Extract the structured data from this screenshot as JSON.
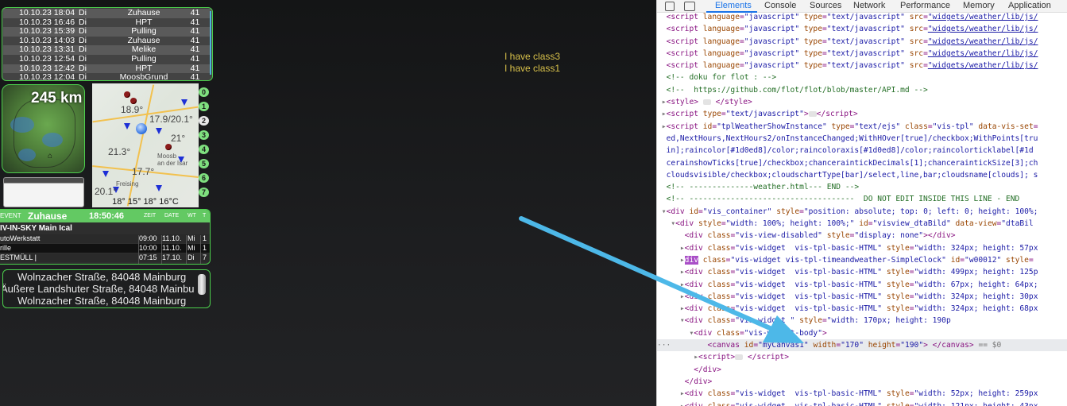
{
  "history": [
    [
      "10.10.23 18:04",
      "Di",
      "Zuhause",
      "41"
    ],
    [
      "10.10.23 16:46",
      "Di",
      "HPT",
      "41"
    ],
    [
      "10.10.23 15:39",
      "Di",
      "Pulling",
      "41"
    ],
    [
      "10.10.23 14:03",
      "Di",
      "Zuhause",
      "41"
    ],
    [
      "10.10.23 13:31",
      "Di",
      "Melike",
      "41"
    ],
    [
      "10.10.23 12:54",
      "Di",
      "Pulling",
      "41"
    ],
    [
      "10.10.23 12:42",
      "Di",
      "HPT",
      "41"
    ],
    [
      "10.10.23 12:04",
      "Di",
      "MoosbGrund",
      "41"
    ]
  ],
  "radar": {
    "distance": "245 km"
  },
  "weather_map": {
    "temps": [
      "18.9°",
      "17.9/20.1°",
      "21.3°",
      "21°",
      "17.7°",
      "20.1°"
    ],
    "towns": [
      "Moosb",
      "an der Isar",
      "Freising"
    ],
    "footer": "18° 15° 18° 16°C"
  },
  "numbers": [
    "0",
    "1",
    "2",
    "3",
    "4",
    "5",
    "6",
    "7"
  ],
  "calendar": {
    "header": {
      "event": "EVENT",
      "location": "Zuhause",
      "time": "18:50:46",
      "zeit": "ZEIT",
      "date": "DATE",
      "wt": "WT",
      "t": "T"
    },
    "subtitle": "IV-IN-SKY Main Ical",
    "rows": [
      [
        "utoWerkstatt",
        "09:00",
        "11.10.",
        "Mi",
        "1"
      ],
      [
        "rille",
        "10:00",
        "11.10.",
        "Mi",
        "1"
      ],
      [
        "ESTMÜLL |",
        "07:15",
        "17.10.",
        "Di",
        "7"
      ]
    ]
  },
  "addresses": [
    "Wolnzacher Straße, 84048 Mainburg",
    "Äußere Landshuter Straße, 84048 Mainbu",
    "Wolnzacher Straße, 84048 Mainburg"
  ],
  "class_text": [
    "I have class3",
    "I have class1"
  ],
  "devtools": {
    "tabs": [
      "Elements",
      "Console",
      "Sources",
      "Network",
      "Performance",
      "Memory",
      "Application"
    ],
    "active_tab": "Elements"
  },
  "colors": {
    "accent_green": "#4ccf4c",
    "arrow_blue": "#4db8e8",
    "devtools_blue": "#1a73e8"
  }
}
